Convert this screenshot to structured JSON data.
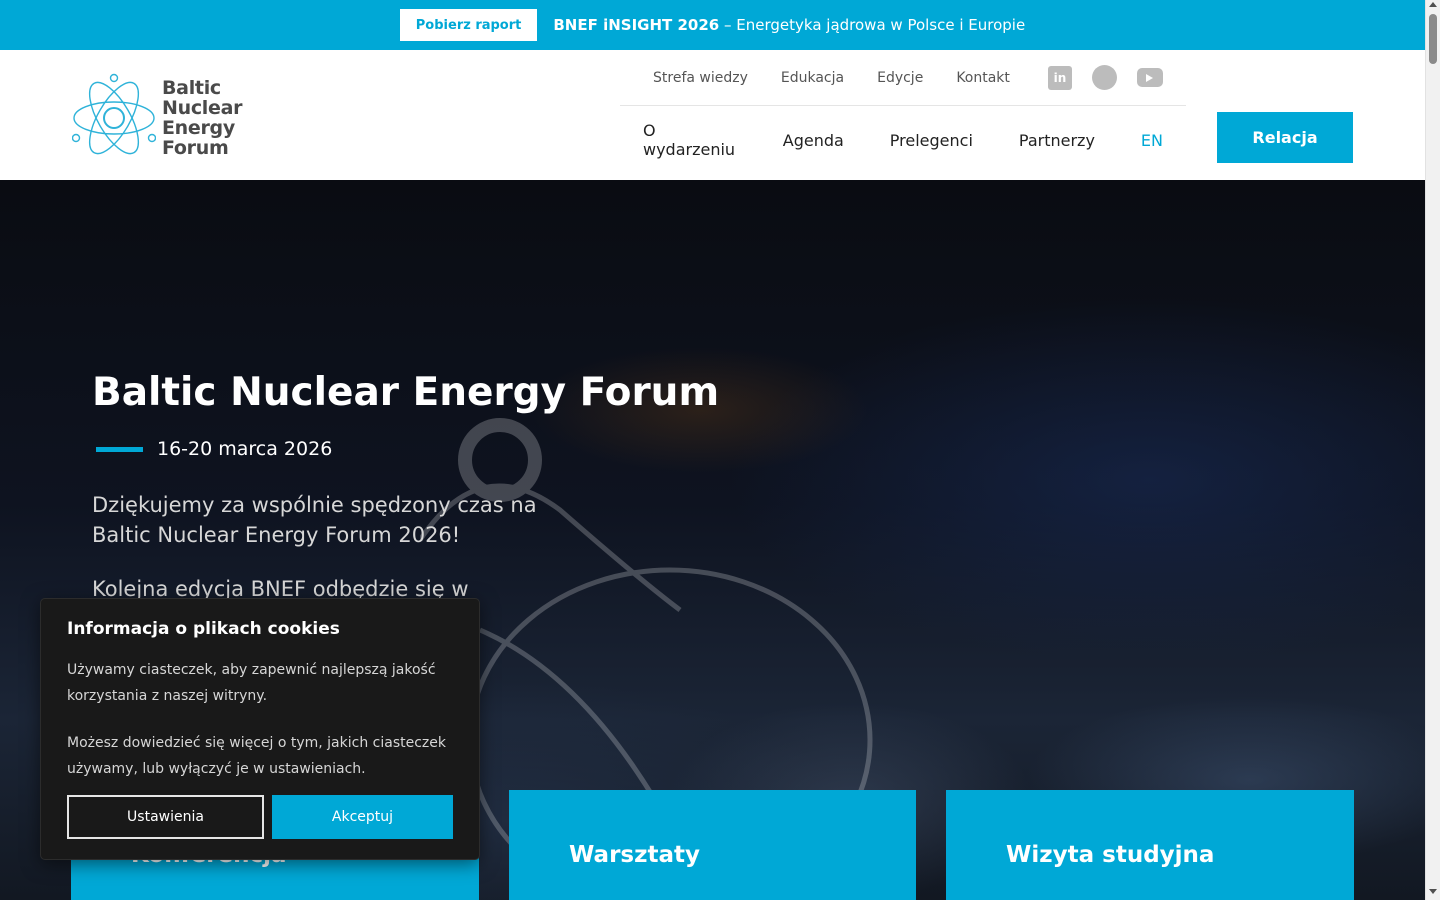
{
  "topbar": {
    "button_label": "Pobierz raport",
    "promo_bold": "BNEF iNSIGHT 2026",
    "promo_text": " – Energetyka jądrowa w Polsce i Europie"
  },
  "logo": {
    "line1": "Baltic",
    "line2": "Nuclear",
    "line3": "Energy",
    "line4": "Forum"
  },
  "secondary_nav": [
    "Strefa wiedzy",
    "Edukacja",
    "Edycje",
    "Kontakt"
  ],
  "social": {
    "linkedin": "in"
  },
  "main_nav": [
    "O wydarzeniu",
    "Agenda",
    "Prelegenci",
    "Partnerzy",
    "EN"
  ],
  "cta_label": "Relacja",
  "hero": {
    "title": "Baltic Nuclear Energy Forum",
    "date": "16-20 marca 2026",
    "desc1": "Dziękujemy za wspólnie spędzony czas na Baltic Nuclear Energy Forum 2026!",
    "desc2": "Kolejna edycja BNEF odbędzie się w"
  },
  "cards": [
    "Konferencja",
    "Warsztaty",
    "Wizyta studyjna"
  ],
  "cookie": {
    "title": "Informacja o plikach cookies",
    "text1": "Używamy ciasteczek, aby zapewnić najlepszą jakość korzystania z naszej witryny.",
    "text2": "Możesz dowiedzieć się więcej o tym, jakich ciasteczek używamy, lub wyłączyć je w ustawieniach.",
    "settings_label": "Ustawienia",
    "accept_label": "Akceptuj"
  },
  "colors": {
    "accent": "#00a8d6",
    "cookie_bg": "#191919"
  }
}
